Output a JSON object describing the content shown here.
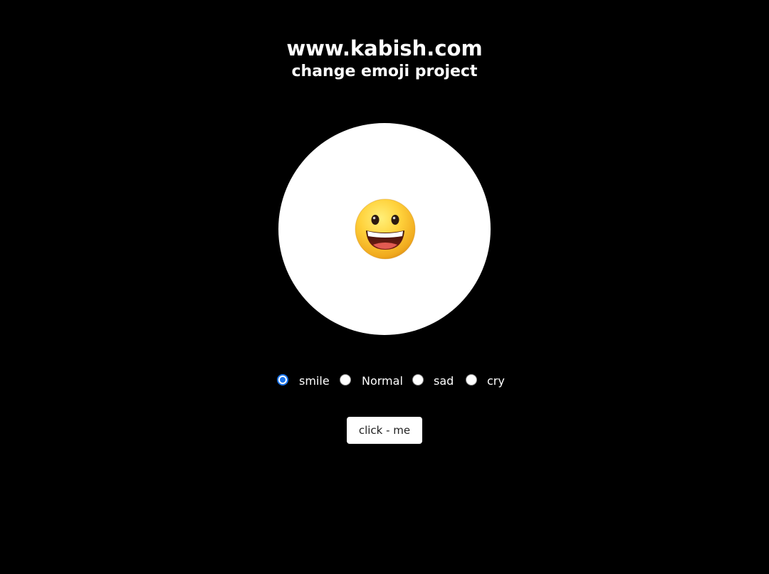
{
  "header": {
    "title": "www.kabish.com",
    "subtitle": "change emoji project"
  },
  "emoji": {
    "icon": "grinning-face-icon",
    "mood": "smile"
  },
  "options": [
    {
      "label": "smile",
      "checked": true
    },
    {
      "label": "Normal",
      "checked": false
    },
    {
      "label": "sad",
      "checked": false
    },
    {
      "label": "cry",
      "checked": false
    }
  ],
  "button": {
    "label": "click - me"
  },
  "colors": {
    "background": "#000000",
    "circle": "#ffffff",
    "radio_accent": "#1a73e8"
  }
}
